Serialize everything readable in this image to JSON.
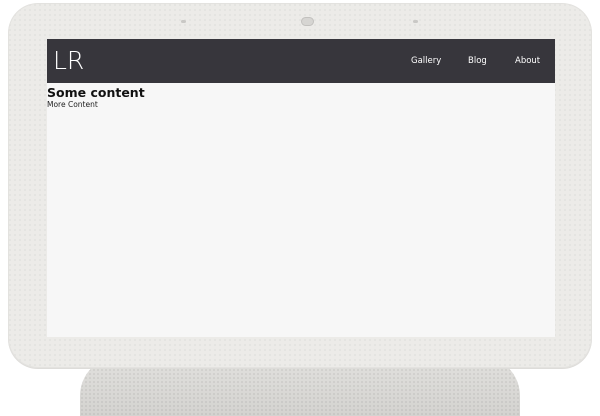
{
  "navbar": {
    "logo": "LR",
    "links": [
      {
        "label": "Gallery"
      },
      {
        "label": "Blog"
      },
      {
        "label": "About"
      }
    ]
  },
  "main": {
    "heading": "Some content",
    "subtext": "More Content"
  },
  "colors": {
    "navbar_bg": "#37363c",
    "screen_bg": "#f7f7f7",
    "device_bezel": "#ecebe8"
  }
}
